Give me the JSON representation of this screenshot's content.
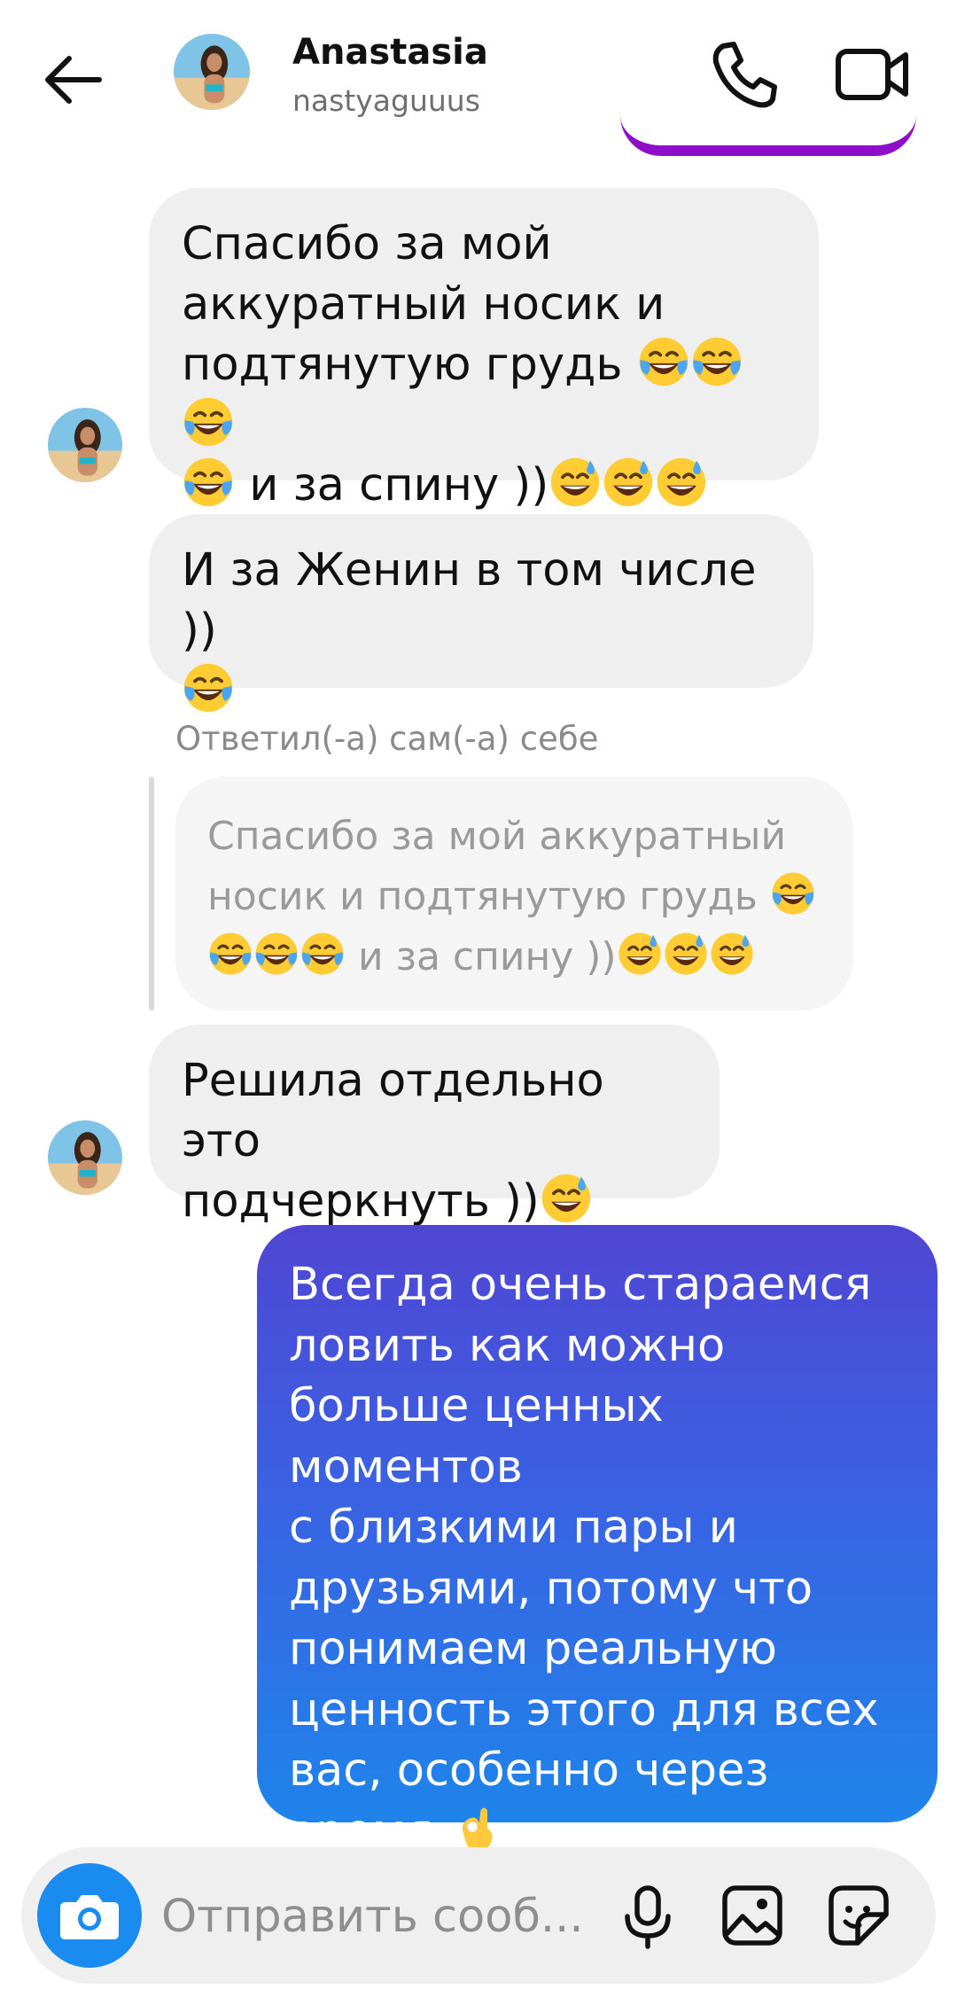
{
  "header": {
    "name": "Anastasia",
    "username": "nastyaguuus"
  },
  "messages": [
    {
      "text_line1": "Спасибо за мой",
      "text_line2": "аккуратный носик и",
      "text_line3": "подтянутую грудь",
      "text_line4": " и за спину ))"
    },
    {
      "text_line1": "И за Женин в том числе ))"
    },
    {
      "reply_label": "Ответил(-а) сам(-а) себе",
      "quote_line1": "Спасибо за мой аккуратный",
      "quote_line2": "носик и подтянутую грудь",
      "quote_line3": " и за спину ))"
    },
    {
      "text_line1": "Решила отдельно это",
      "text_line2": "подчеркнуть ))"
    }
  ],
  "own_message": {
    "lines": [
      "Всегда очень стараемся",
      "ловить как можно",
      "больше ценных моментов",
      "с близкими пары и",
      "друзьями, потому что",
      "понимаем реальную",
      "ценность этого для всех",
      "вас, особенно через",
      "время "
    ]
  },
  "composer": {
    "placeholder": "Отправить сооб..."
  },
  "colors": {
    "bubble_incoming": "#efefef",
    "bubble_outgoing_top": "#4f46d3",
    "bubble_outgoing_bottom": "#1f84ea",
    "camera_button": "#1a8cf0",
    "prev_bubble_edge": "#8e0ec9"
  },
  "icons": {
    "back": "arrow-left-icon",
    "call": "phone-icon",
    "video": "video-camera-icon",
    "camera": "camera-icon",
    "mic": "microphone-icon",
    "gallery": "image-icon",
    "sticker": "sticker-icon",
    "laugh": "face-with-tears-of-joy",
    "sweat": "grinning-face-with-sweat",
    "ok": "ok-hand"
  }
}
